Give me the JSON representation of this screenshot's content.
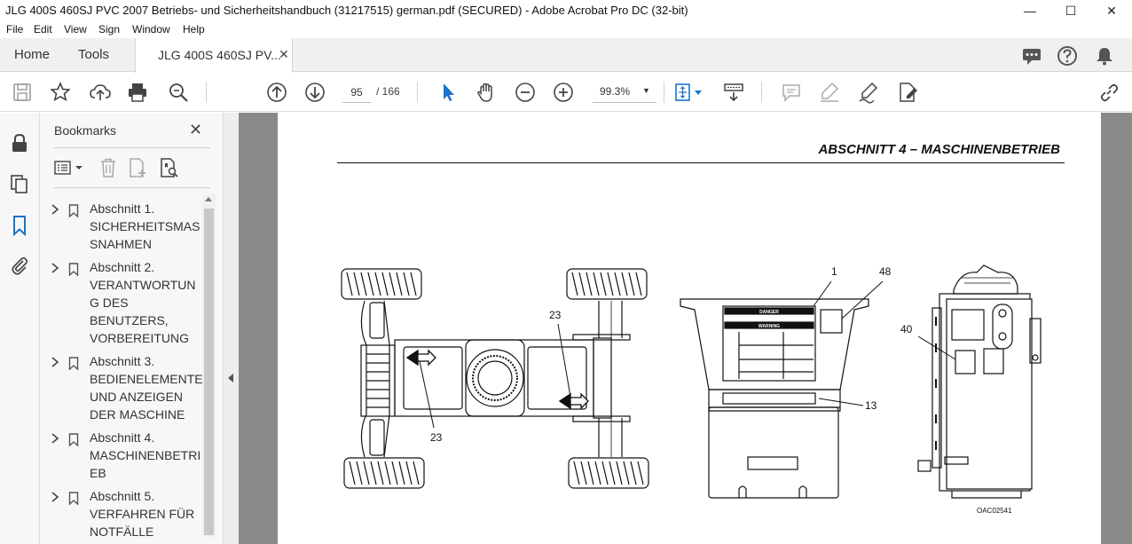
{
  "window": {
    "title": "JLG 400S 460SJ PVC 2007 Betriebs- und Sicherheitshandbuch (31217515) german.pdf (SECURED) - Adobe Acrobat Pro DC (32-bit)",
    "minimize": "—",
    "maximize": "☐",
    "close": "✕"
  },
  "menu": [
    "File",
    "Edit",
    "View",
    "Sign",
    "Window",
    "Help"
  ],
  "tabs": {
    "home": "Home",
    "tools": "Tools",
    "document": "JLG 400S 460SJ PV...",
    "close": "✕"
  },
  "toolbar": {
    "page_current": "95",
    "page_total": "/ 166",
    "zoom": "99.3%",
    "zoom_caret": "▼"
  },
  "bookmarks": {
    "title": "Bookmarks",
    "close": "✕",
    "items": [
      {
        "lines": [
          "Abschnitt 1.",
          "SICHERHEITSMAS",
          "SNAHMEN"
        ]
      },
      {
        "lines": [
          "Abschnitt 2.",
          "VERANTWORTUN",
          "G DES",
          "BENUTZERS,",
          "VORBEREITUNG"
        ]
      },
      {
        "lines": [
          "Abschnitt 3.",
          "BEDIENELEMENTE",
          "UND ANZEIGEN",
          "DER MASCHINE"
        ]
      },
      {
        "lines": [
          "Abschnitt 4.",
          "MASCHINENBETRI",
          "EB"
        ]
      },
      {
        "lines": [
          "Abschnitt 5.",
          "VERFAHREN FÜR",
          "NOTFÄLLE"
        ]
      }
    ]
  },
  "document": {
    "heading": "ABSCHNITT 4 – MASCHINENBETRIEB",
    "callouts": {
      "c23_top": "23",
      "c23_bottom": "23",
      "c1": "1",
      "c48": "48",
      "c13": "13",
      "c40": "40"
    },
    "decal_danger": "DANGER",
    "decal_warning": "WARNING",
    "figure_id": "OAC02541"
  },
  "colors": {
    "accent_blue": "#1a73c8",
    "doc_background": "#8a8a8a",
    "panel_background": "#f7f7f7"
  }
}
